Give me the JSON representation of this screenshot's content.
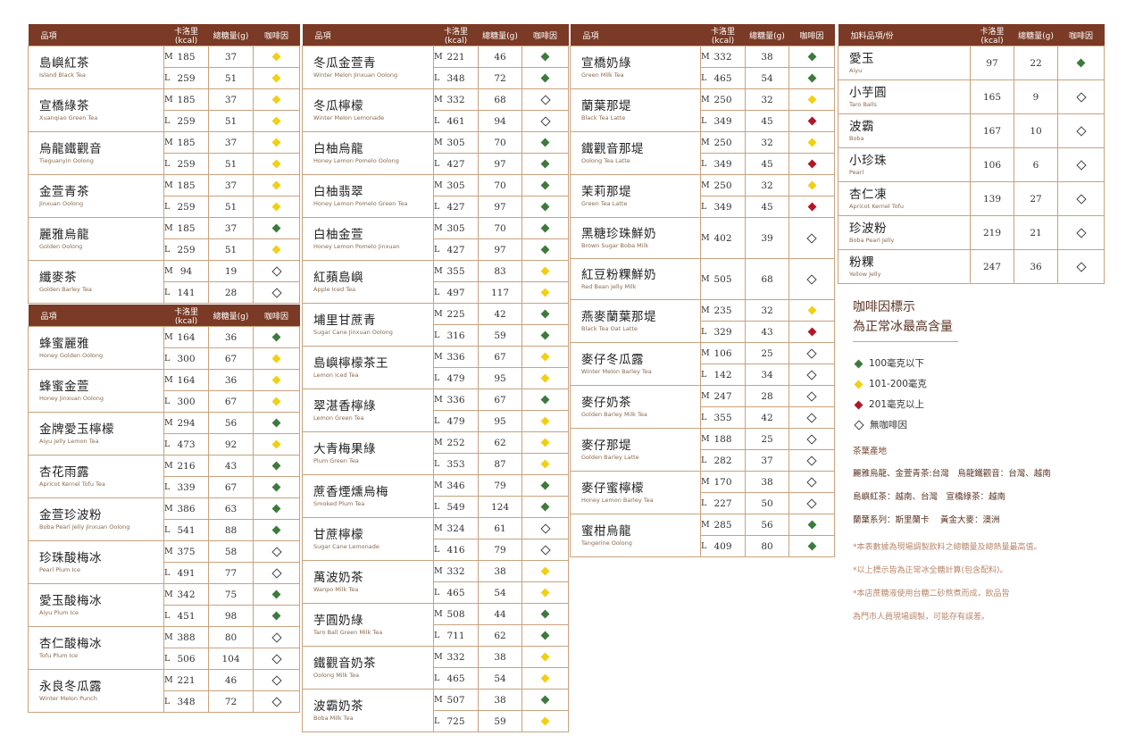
{
  "headers": {
    "name": "品項",
    "addon_name": "加料品項/份",
    "cal": "卡洛里(kcal)",
    "sugar": "總糖量(g)",
    "caffeine": "咖啡因"
  },
  "sizes": {
    "m": "M",
    "l": "L"
  },
  "caffeine_colors": {
    "green": "#3e7a3e",
    "yellow": "#f1cf13",
    "red": "#b01828",
    "none": "#ffffff"
  },
  "col1a": [
    {
      "zh": "島嶼紅茶",
      "en": "Island Black Tea",
      "m": {
        "cal": "185",
        "sugar": "37",
        "caf": "yellow"
      },
      "l": {
        "cal": "259",
        "sugar": "51",
        "caf": "yellow"
      }
    },
    {
      "zh": "宣橋綠茶",
      "en": "Xuanqiao Green Tea",
      "m": {
        "cal": "185",
        "sugar": "37",
        "caf": "yellow"
      },
      "l": {
        "cal": "259",
        "sugar": "51",
        "caf": "yellow"
      }
    },
    {
      "zh": "烏龍鐵觀音",
      "en": "Tieguanyin Oolong",
      "m": {
        "cal": "185",
        "sugar": "37",
        "caf": "yellow"
      },
      "l": {
        "cal": "259",
        "sugar": "51",
        "caf": "yellow"
      }
    },
    {
      "zh": "金萱青茶",
      "en": "Jinxuan Oolong",
      "m": {
        "cal": "185",
        "sugar": "37",
        "caf": "yellow"
      },
      "l": {
        "cal": "259",
        "sugar": "51",
        "caf": "yellow"
      }
    },
    {
      "zh": "麗雅烏龍",
      "en": "Golden Oolong",
      "m": {
        "cal": "185",
        "sugar": "37",
        "caf": "green"
      },
      "l": {
        "cal": "259",
        "sugar": "51",
        "caf": "yellow"
      }
    },
    {
      "zh": "纖麥茶",
      "en": "Golden Barley Tea",
      "m": {
        "cal": "94",
        "sugar": "19",
        "caf": "none"
      },
      "l": {
        "cal": "141",
        "sugar": "28",
        "caf": "none"
      }
    }
  ],
  "col1b": [
    {
      "zh": "蜂蜜麗雅",
      "en": "Honey Golden Oolong",
      "m": {
        "cal": "164",
        "sugar": "36",
        "caf": "green"
      },
      "l": {
        "cal": "300",
        "sugar": "67",
        "caf": "yellow"
      }
    },
    {
      "zh": "蜂蜜金萱",
      "en": "Honey Jinxuan Oolong",
      "m": {
        "cal": "164",
        "sugar": "36",
        "caf": "yellow"
      },
      "l": {
        "cal": "300",
        "sugar": "67",
        "caf": "yellow"
      }
    },
    {
      "zh": "金牌愛玉檸檬",
      "en": "Aiyu Jelly Lemon Tea",
      "m": {
        "cal": "294",
        "sugar": "56",
        "caf": "green"
      },
      "l": {
        "cal": "473",
        "sugar": "92",
        "caf": "yellow"
      }
    },
    {
      "zh": "杏花雨露",
      "en": "Apricot Kernel Tofu Tea",
      "m": {
        "cal": "216",
        "sugar": "43",
        "caf": "green"
      },
      "l": {
        "cal": "339",
        "sugar": "67",
        "caf": "green"
      }
    },
    {
      "zh": "金萱珍波粉",
      "en": "Boba Pearl Jelly Jinxuan Oolong",
      "m": {
        "cal": "386",
        "sugar": "63",
        "caf": "green"
      },
      "l": {
        "cal": "541",
        "sugar": "88",
        "caf": "green"
      }
    },
    {
      "zh": "珍珠酸梅冰",
      "en": "Pearl Plum Ice",
      "m": {
        "cal": "375",
        "sugar": "58",
        "caf": "none"
      },
      "l": {
        "cal": "491",
        "sugar": "77",
        "caf": "none"
      }
    },
    {
      "zh": "愛玉酸梅冰",
      "en": "Aiyu Plum Ice",
      "m": {
        "cal": "342",
        "sugar": "75",
        "caf": "green"
      },
      "l": {
        "cal": "451",
        "sugar": "98",
        "caf": "green"
      }
    },
    {
      "zh": "杏仁酸梅冰",
      "en": "Tofu Plum Ice",
      "m": {
        "cal": "388",
        "sugar": "80",
        "caf": "none"
      },
      "l": {
        "cal": "506",
        "sugar": "104",
        "caf": "none"
      }
    },
    {
      "zh": "永良冬瓜露",
      "en": "Winter Melon Punch",
      "m": {
        "cal": "221",
        "sugar": "46",
        "caf": "none"
      },
      "l": {
        "cal": "348",
        "sugar": "72",
        "caf": "none"
      }
    }
  ],
  "col2": [
    {
      "zh": "冬瓜金萱青",
      "en": "Winter Melon Jinxuan Oolong",
      "m": {
        "cal": "221",
        "sugar": "46",
        "caf": "green"
      },
      "l": {
        "cal": "348",
        "sugar": "72",
        "caf": "green"
      }
    },
    {
      "zh": "冬瓜檸檬",
      "en": "Winter Melon Lemonade",
      "m": {
        "cal": "332",
        "sugar": "68",
        "caf": "none"
      },
      "l": {
        "cal": "461",
        "sugar": "94",
        "caf": "none"
      }
    },
    {
      "zh": "白柚烏龍",
      "en": "Honey Lemon Pomelo Oolong",
      "m": {
        "cal": "305",
        "sugar": "70",
        "caf": "green"
      },
      "l": {
        "cal": "427",
        "sugar": "97",
        "caf": "green"
      }
    },
    {
      "zh": "白柚翡翠",
      "en": "Honey Lemon Pomelo Green Tea",
      "m": {
        "cal": "305",
        "sugar": "70",
        "caf": "green"
      },
      "l": {
        "cal": "427",
        "sugar": "97",
        "caf": "green"
      }
    },
    {
      "zh": "白柚金萱",
      "en": "Honey Lemon Pomelo Jinxuan",
      "m": {
        "cal": "305",
        "sugar": "70",
        "caf": "green"
      },
      "l": {
        "cal": "427",
        "sugar": "97",
        "caf": "green"
      }
    },
    {
      "zh": "紅蘋島嶼",
      "en": "Apple Iced Tea",
      "m": {
        "cal": "355",
        "sugar": "83",
        "caf": "yellow"
      },
      "l": {
        "cal": "497",
        "sugar": "117",
        "caf": "yellow"
      }
    },
    {
      "zh": "埔里甘蔗青",
      "en": "Sugar Cane Jinxuan Oolong",
      "m": {
        "cal": "225",
        "sugar": "42",
        "caf": "green"
      },
      "l": {
        "cal": "316",
        "sugar": "59",
        "caf": "green"
      }
    },
    {
      "zh": "島嶼檸檬茶王",
      "en": "Lemon Iced Tea",
      "m": {
        "cal": "336",
        "sugar": "67",
        "caf": "yellow"
      },
      "l": {
        "cal": "479",
        "sugar": "95",
        "caf": "yellow"
      }
    },
    {
      "zh": "翠湛香檸綠",
      "en": "Lemon Green Tea",
      "m": {
        "cal": "336",
        "sugar": "67",
        "caf": "green"
      },
      "l": {
        "cal": "479",
        "sugar": "95",
        "caf": "yellow"
      }
    },
    {
      "zh": "大青梅果綠",
      "en": "Plum Green Tea",
      "m": {
        "cal": "252",
        "sugar": "62",
        "caf": "yellow"
      },
      "l": {
        "cal": "353",
        "sugar": "87",
        "caf": "yellow"
      }
    },
    {
      "zh": "蔗香煙燻烏梅",
      "en": "Smoked Plum Tea",
      "m": {
        "cal": "346",
        "sugar": "79",
        "caf": "green"
      },
      "l": {
        "cal": "549",
        "sugar": "124",
        "caf": "green"
      }
    },
    {
      "zh": "甘蔗檸檬",
      "en": "Sugar Cane Lemonade",
      "m": {
        "cal": "324",
        "sugar": "61",
        "caf": "none"
      },
      "l": {
        "cal": "416",
        "sugar": "79",
        "caf": "none"
      }
    },
    {
      "zh": "萬波奶茶",
      "en": "Wanpo Milk Tea",
      "m": {
        "cal": "332",
        "sugar": "38",
        "caf": "yellow"
      },
      "l": {
        "cal": "465",
        "sugar": "54",
        "caf": "yellow"
      }
    },
    {
      "zh": "芋圓奶綠",
      "en": "Taro Ball Green Milk Tea",
      "m": {
        "cal": "508",
        "sugar": "44",
        "caf": "green"
      },
      "l": {
        "cal": "711",
        "sugar": "62",
        "caf": "green"
      }
    },
    {
      "zh": "鐵觀音奶茶",
      "en": "Oolong Milk Tea",
      "m": {
        "cal": "332",
        "sugar": "38",
        "caf": "yellow"
      },
      "l": {
        "cal": "465",
        "sugar": "54",
        "caf": "yellow"
      }
    },
    {
      "zh": "波霸奶茶",
      "en": "Boba Milk Tea",
      "m": {
        "cal": "507",
        "sugar": "38",
        "caf": "green"
      },
      "l": {
        "cal": "725",
        "sugar": "59",
        "caf": "yellow"
      }
    }
  ],
  "col3": [
    {
      "zh": "宣橋奶綠",
      "en": "Green Milk Tea",
      "m": {
        "cal": "332",
        "sugar": "38",
        "caf": "green"
      },
      "l": {
        "cal": "465",
        "sugar": "54",
        "caf": "green"
      }
    },
    {
      "zh": "蘭葉那堤",
      "en": "Black Tea Latte",
      "m": {
        "cal": "250",
        "sugar": "32",
        "caf": "yellow"
      },
      "l": {
        "cal": "349",
        "sugar": "45",
        "caf": "red"
      }
    },
    {
      "zh": "鐵觀音那堤",
      "en": "Oolong Tea Latte",
      "m": {
        "cal": "250",
        "sugar": "32",
        "caf": "yellow"
      },
      "l": {
        "cal": "349",
        "sugar": "45",
        "caf": "red"
      }
    },
    {
      "zh": "茉莉那堤",
      "en": "Green Tea Latte",
      "m": {
        "cal": "250",
        "sugar": "32",
        "caf": "yellow"
      },
      "l": {
        "cal": "349",
        "sugar": "45",
        "caf": "red"
      }
    },
    {
      "zh": "黑糖珍珠鮮奶",
      "en": "Brown Sugar Boba Milk",
      "single": true,
      "m": {
        "cal": "402",
        "sugar": "39",
        "caf": "none"
      }
    },
    {
      "zh": "紅豆粉粿鮮奶",
      "en": "Red Bean Jelly Milk",
      "single": true,
      "m": {
        "cal": "505",
        "sugar": "68",
        "caf": "none"
      }
    },
    {
      "zh": "燕麥蘭葉那堤",
      "en": "Black Tea Oat Latte",
      "m": {
        "cal": "235",
        "sugar": "32",
        "caf": "yellow"
      },
      "l": {
        "cal": "329",
        "sugar": "43",
        "caf": "red"
      }
    },
    {
      "zh": "麥仔冬瓜露",
      "en": "Winter Melon Barley Tea",
      "m": {
        "cal": "106",
        "sugar": "25",
        "caf": "none"
      },
      "l": {
        "cal": "142",
        "sugar": "34",
        "caf": "none"
      }
    },
    {
      "zh": "麥仔奶茶",
      "en": "Golden Barley Milk Tea",
      "m": {
        "cal": "247",
        "sugar": "28",
        "caf": "none"
      },
      "l": {
        "cal": "355",
        "sugar": "42",
        "caf": "none"
      }
    },
    {
      "zh": "麥仔那堤",
      "en": "Golden Barley Latte",
      "m": {
        "cal": "188",
        "sugar": "25",
        "caf": "none"
      },
      "l": {
        "cal": "282",
        "sugar": "37",
        "caf": "none"
      }
    },
    {
      "zh": "麥仔蜜檸檬",
      "en": "Honey Lemon Barley Tea",
      "m": {
        "cal": "170",
        "sugar": "38",
        "caf": "none"
      },
      "l": {
        "cal": "227",
        "sugar": "50",
        "caf": "none"
      }
    },
    {
      "zh": "蜜柑烏龍",
      "en": "Tangerine Oolong",
      "m": {
        "cal": "285",
        "sugar": "56",
        "caf": "green"
      },
      "l": {
        "cal": "409",
        "sugar": "80",
        "caf": "green"
      }
    }
  ],
  "addons": [
    {
      "zh": "愛玉",
      "en": "Aiyu",
      "cal": "97",
      "sugar": "22",
      "caf": "green"
    },
    {
      "zh": "小芋圓",
      "en": "Taro Balls",
      "cal": "165",
      "sugar": "9",
      "caf": "none"
    },
    {
      "zh": "波霸",
      "en": "Boba",
      "cal": "167",
      "sugar": "10",
      "caf": "none"
    },
    {
      "zh": "小珍珠",
      "en": "Pearl",
      "cal": "106",
      "sugar": "6",
      "caf": "none"
    },
    {
      "zh": "杏仁凍",
      "en": "Apricot Kernel Tofu",
      "cal": "139",
      "sugar": "27",
      "caf": "none"
    },
    {
      "zh": "珍波粉",
      "en": "Boba Pearl Jelly",
      "cal": "219",
      "sugar": "21",
      "caf": "none"
    },
    {
      "zh": "粉粿",
      "en": "Yellow Jelly",
      "cal": "247",
      "sugar": "36",
      "caf": "none"
    }
  ],
  "legend": {
    "title_line1": "咖啡因標示",
    "title_line2": "為正常冰最高含量",
    "items": [
      {
        "caf": "green",
        "label": "100毫克以下"
      },
      {
        "caf": "yellow",
        "label": "101-200毫克"
      },
      {
        "caf": "red",
        "label": "201毫克以上"
      },
      {
        "caf": "none",
        "label": "無咖啡因"
      }
    ]
  },
  "origin": {
    "title": "茶葉產地",
    "lines": [
      "麗雅烏龍、金萱青茶:台灣　烏龍鐵觀音：台灣、越南",
      "島嶼紅茶：越南、台灣　宣橋綠茶：越南",
      "蘭葉系列：斯里蘭卡　 黃金大麥：澳洲"
    ]
  },
  "notes": [
    "*本表數據為現場調製飲料之總糖量及總熱量最高值。",
    "*以上標示皆為正常冰全糖計算(包含配料)。",
    "*本店蔗糖液使用台糖二砂熬煮而成，飲品皆",
    "為門市人員現場調製，可能存有誤差。"
  ]
}
